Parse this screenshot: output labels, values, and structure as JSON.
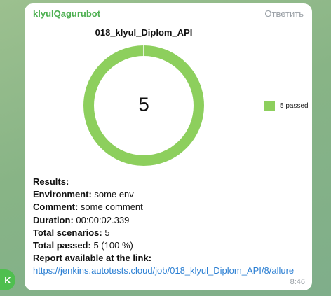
{
  "message": {
    "sender": "klyulQagurubot",
    "reply_label": "Ответить",
    "time": "8:46",
    "avatar_letter": "K"
  },
  "chart_data": {
    "type": "pie",
    "title": "018_klyul_Diplom_API",
    "center_label": "5",
    "slices": [
      {
        "label": "5 passed",
        "value": 5,
        "color": "#8dcf5d"
      }
    ],
    "legend": "right"
  },
  "report": {
    "results_label": "Results:",
    "environment_label": "Environment:",
    "environment_value": "some env",
    "comment_label": "Comment:",
    "comment_value": "some comment",
    "duration_label": "Duration:",
    "duration_value": "00:00:02.339",
    "total_scenarios_label": "Total scenarios:",
    "total_scenarios_value": "5",
    "total_passed_label": "Total passed:",
    "total_passed_value": "5 (100 %)",
    "link_label": "Report available at the link:",
    "link_url": "https://jenkins.autotests.cloud/job/018_klyul_Diplom_API/8/allure"
  }
}
